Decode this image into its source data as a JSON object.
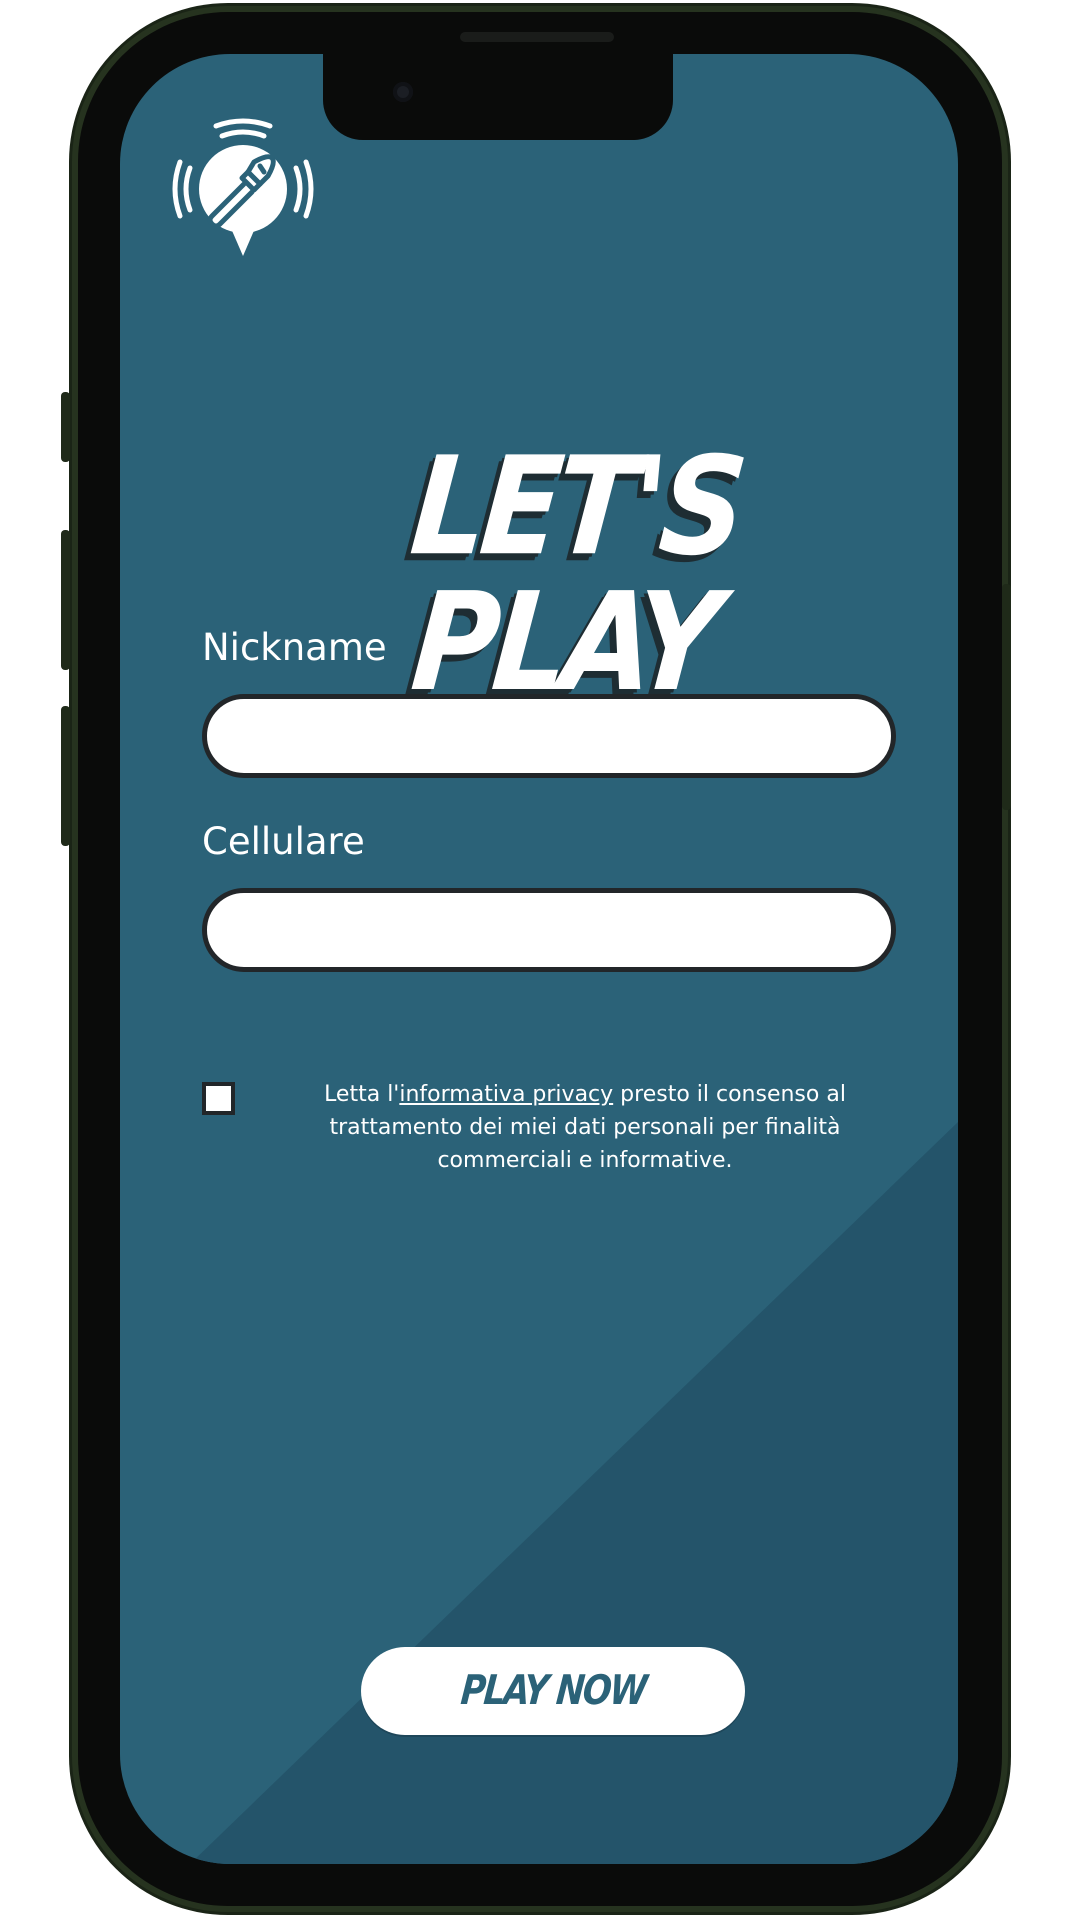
{
  "colors": {
    "screen_background": "#2b6278",
    "diagonal_shade": "#24546a",
    "frame": "#0a0b0a",
    "frame_edge": "#26331f",
    "field_border": "#222629",
    "button_text": "#2b6278"
  },
  "logo": {
    "icon": "paintbrush-speech-bubble-logo"
  },
  "title": "LET'S PLAY",
  "form": {
    "nickname_label": "Nickname",
    "nickname_value": "",
    "cellulare_label": "Cellulare",
    "cellulare_value": "",
    "consent": {
      "checked": false,
      "text_before": "Letta l'",
      "link_text": "informativa privacy",
      "text_after": " presto il consenso al trattamento dei miei dati personali per finalità commerciali e informative."
    }
  },
  "play_button_label": "PLAY NOW"
}
